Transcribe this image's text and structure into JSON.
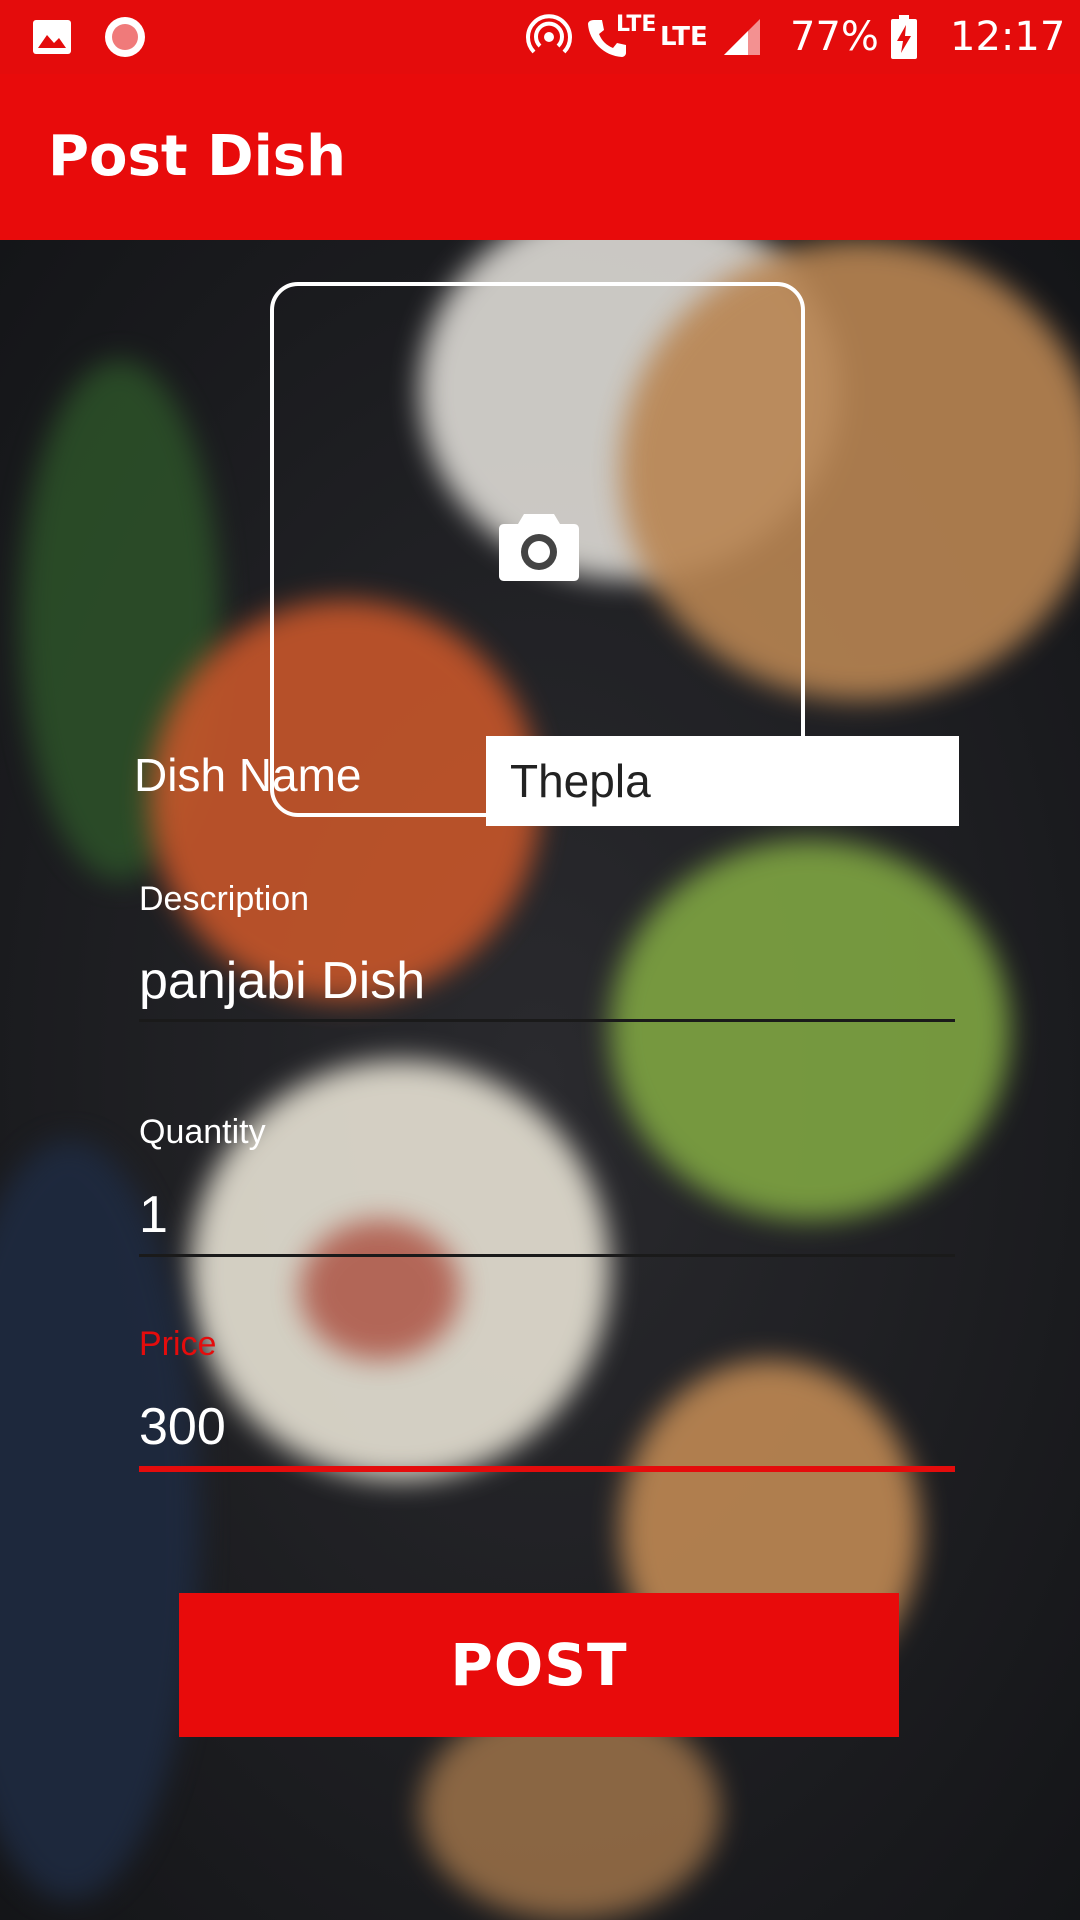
{
  "status_bar": {
    "network_small": "LTE",
    "network": "LTE",
    "battery_percent": "77%",
    "time": "12:17",
    "icons": [
      "gallery-icon",
      "recording-icon",
      "hotspot-icon",
      "volte-call-icon",
      "signal-icon",
      "battery-charging-icon"
    ]
  },
  "app_bar": {
    "title": "Post Dish"
  },
  "form": {
    "image_picker_icon": "camera-icon",
    "dish_name": {
      "label": "Dish Name",
      "value": "Thepla"
    },
    "description": {
      "label": "Description",
      "value": "panjabi Dish"
    },
    "quantity": {
      "label": "Quantity",
      "value": "1"
    },
    "price": {
      "label": "Price",
      "value": "300"
    },
    "submit_label": "POST"
  },
  "colors": {
    "primary": "#e80b0b",
    "accent": "#e40c0c",
    "on_primary": "#ffffff"
  }
}
